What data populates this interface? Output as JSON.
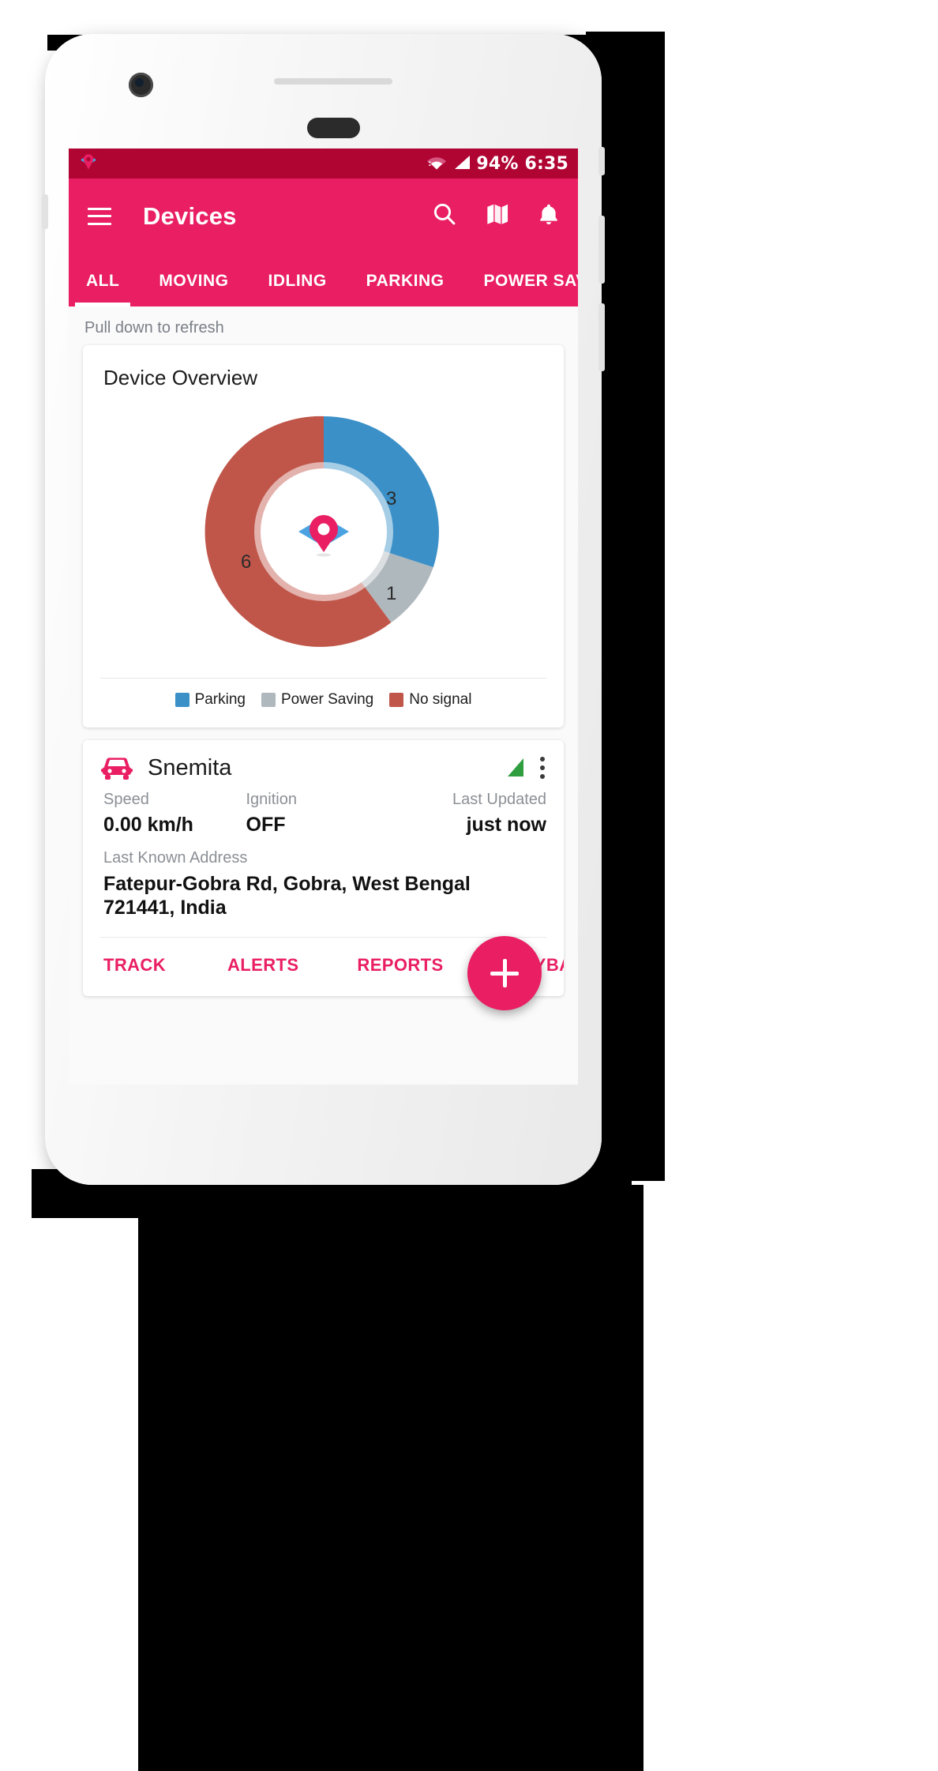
{
  "status_bar": {
    "wifi_icon": "wifi-icon",
    "signal_icon": "cellular-signal-icon",
    "battery_and_time": "94% 6:35"
  },
  "app_bar": {
    "menu_icon": "hamburger-menu-icon",
    "title": "Devices",
    "actions": [
      {
        "icon": "search-icon"
      },
      {
        "icon": "map-icon"
      },
      {
        "icon": "bell-icon"
      }
    ]
  },
  "tabs": {
    "items": [
      {
        "label": "ALL",
        "active": true
      },
      {
        "label": "MOVING",
        "active": false
      },
      {
        "label": "IDLING",
        "active": false
      },
      {
        "label": "PARKING",
        "active": false
      },
      {
        "label": "POWER SAVING",
        "active": false
      }
    ]
  },
  "content": {
    "pull_to_refresh": "Pull down to refresh"
  },
  "overview_card": {
    "title": "Device Overview",
    "center_logo_icon": "eye-pin-logo-icon"
  },
  "chart_data": {
    "type": "pie",
    "title": "Device Overview",
    "categories": [
      "Parking",
      "Power Saving",
      "No signal"
    ],
    "values": [
      3,
      1,
      6
    ],
    "colors": [
      "#3B90C8",
      "#AFB8BD",
      "#C0564A"
    ],
    "labels_shown": [
      "3",
      "1",
      "6"
    ],
    "total": 10,
    "donut": true,
    "legend_position": "bottom",
    "xlabel": "",
    "ylabel": ""
  },
  "device_card": {
    "vehicle_icon": "car-icon",
    "name": "Snemita",
    "signal_icon": "signal-strength-icon",
    "menu_icon": "kebab-menu-icon",
    "stats": [
      {
        "label": "Speed",
        "value": "0.00 km/h"
      },
      {
        "label": "Ignition",
        "value": "OFF"
      },
      {
        "label": "Last Updated",
        "value": "just now"
      }
    ],
    "address_label": "Last Known Address",
    "address_value": "Fatepur-Gobra Rd, Gobra, West Bengal 721441, India",
    "actions": [
      {
        "label": "TRACK"
      },
      {
        "label": "ALERTS"
      },
      {
        "label": "REPORTS"
      },
      {
        "label": "PLAYBACK"
      }
    ]
  },
  "fab": {
    "icon": "plus-icon",
    "label": "+"
  },
  "theme": {
    "primary": "#e91e63",
    "primary_dark": "#b00433",
    "parking": "#3B90C8",
    "power_saving": "#AFB8BD",
    "no_signal": "#C0564A",
    "signal_green": "#2E9E3E"
  }
}
